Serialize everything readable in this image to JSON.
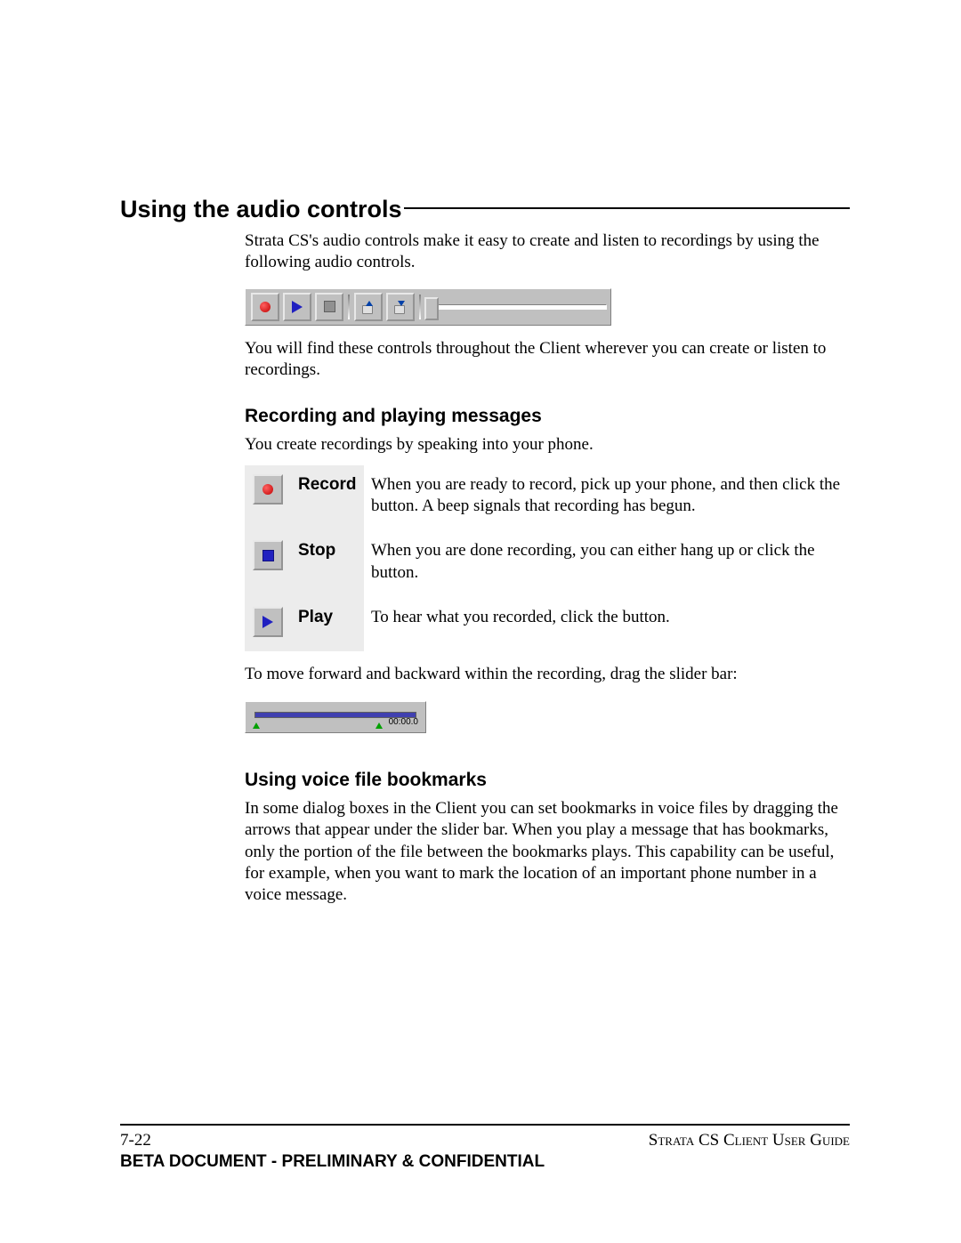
{
  "section_title": "Using the audio controls",
  "intro": "Strata CS's audio controls make it easy to create and listen to recordings by using the following audio controls.",
  "after_toolbar": "You will find these controls throughout the Client wherever you can create or listen to recordings.",
  "sub1_title": "Recording and playing messages",
  "sub1_intro": "You create recordings by speaking into your phone.",
  "controls": [
    {
      "icon": "record",
      "label": "Record",
      "desc": "When you are ready to record, pick up your phone, and then click the button. A beep signals that recording has begun."
    },
    {
      "icon": "stop",
      "label": "Stop",
      "desc": "When you are done recording, you can either hang up or click the button."
    },
    {
      "icon": "play",
      "label": "Play",
      "desc": "To hear what you recorded, click the button."
    }
  ],
  "slider_note": "To move forward and backward within the recording, drag the slider bar:",
  "slider_time": "00:00.0",
  "sub2_title": "Using voice file bookmarks",
  "sub2_body": "In some dialog boxes in the Client you can set bookmarks in voice files by dragging the arrows that appear under the slider bar. When you play a message that has bookmarks, only the portion of the file between the bookmarks plays. This capability can be useful, for example, when you want to mark the location of an important phone number in a voice message.",
  "footer": {
    "page": "7-22",
    "guide": "Strata CS Client User Guide",
    "beta": "BETA DOCUMENT - PRELIMINARY & CONFIDENTIAL"
  }
}
